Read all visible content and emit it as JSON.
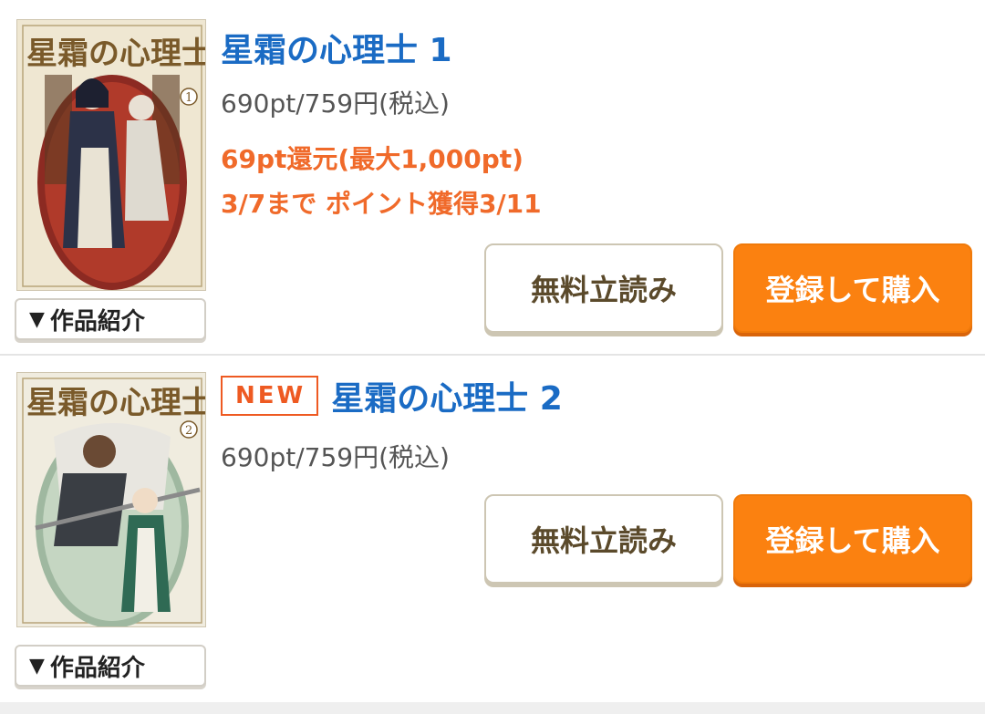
{
  "items": [
    {
      "title": "星霜の心理士 1",
      "is_new": false,
      "price": "690pt/759円(税込)",
      "campaign_points": "69pt還元(最大1,000pt)",
      "campaign_dates": "3/7まで ポイント獲得3/11",
      "intro_label": "作品紹介",
      "free_label": "無料立読み",
      "buy_label": "登録して購入",
      "cover_title": "星霜の心理士",
      "cover_volume": "1"
    },
    {
      "title": "星霜の心理士 2",
      "is_new": true,
      "new_label": "NEW",
      "price": "690pt/759円(税込)",
      "intro_label": "作品紹介",
      "free_label": "無料立読み",
      "buy_label": "登録して購入",
      "cover_title": "星霜の心理士",
      "cover_volume": "2"
    }
  ],
  "colors": {
    "title_blue": "#1a6bc4",
    "campaign_orange": "#f06a2a",
    "buy_orange": "#fb8110",
    "new_badge": "#ee5a22"
  },
  "icons": {
    "intro_toggle": "triangle-down-icon"
  }
}
